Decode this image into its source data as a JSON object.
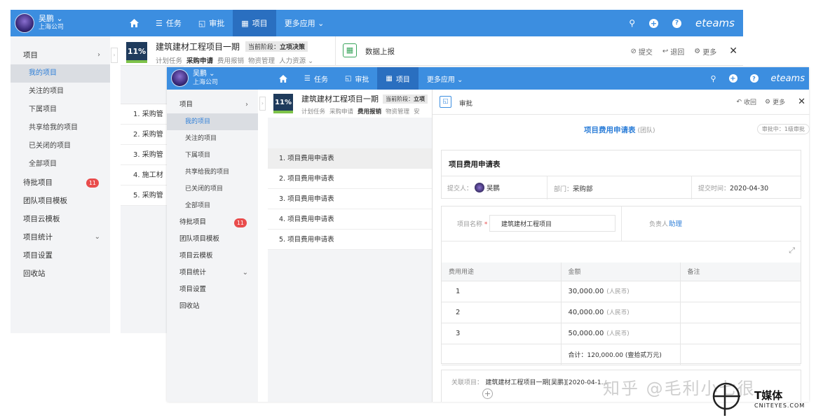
{
  "back": {
    "user": {
      "name": "吴鹏 ⌄",
      "company": "上海公司"
    },
    "nav": [
      {
        "label": "任务",
        "icon": "list-icon"
      },
      {
        "label": "审批",
        "icon": "approval-icon"
      },
      {
        "label": "项目",
        "icon": "project-icon"
      },
      {
        "label": "更多应用 ⌄",
        "icon": ""
      }
    ],
    "brand": "eteams",
    "sidebar": {
      "group": "项目",
      "items": [
        "我的项目",
        "关注的项目",
        "下属项目",
        "共享给我的项目",
        "已关闭的项目",
        "全部项目"
      ],
      "pending": "待批项目",
      "pending_count": "11",
      "others": [
        "团队项目模板",
        "项目云模板",
        "项目统计",
        "项目设置",
        "回收站"
      ]
    },
    "project": {
      "pct": "11%",
      "title": "建筑建材工程项目一期",
      "stage_label": "当前阶段：",
      "stage": "立项决策",
      "subnav": [
        "计划任务",
        "采购申请",
        "费用报销",
        "物资管理",
        "人力资源 ⌄"
      ],
      "data_report": "数据上报",
      "actions": {
        "submit": "提交",
        "return": "退回",
        "more": "更多"
      }
    },
    "list": [
      "1.  采购管",
      "2.  采购管",
      "3.  采购管",
      "4.  施工材",
      "5.  采购管"
    ]
  },
  "front": {
    "user": {
      "name": "吴鹏 ⌄",
      "company": "上海公司"
    },
    "nav": [
      {
        "label": "任务"
      },
      {
        "label": "审批"
      },
      {
        "label": "项目"
      },
      {
        "label": "更多应用 ⌄"
      }
    ],
    "brand": "eteams",
    "sidebar": {
      "group": "项目",
      "items": [
        "我的项目",
        "关注的项目",
        "下属项目",
        "共享给我的项目",
        "已关闭的项目",
        "全部项目"
      ],
      "pending": "待批项目",
      "pending_count": "11",
      "others": [
        "团队项目模板",
        "项目云模板",
        "项目统计",
        "项目设置",
        "回收站"
      ]
    },
    "project": {
      "pct": "11%",
      "title": "建筑建材工程项目一期",
      "stage_label": "当前阶段：",
      "stage": "立项",
      "subnav": [
        "计划任务",
        "采购申请",
        "费用报销",
        "物资管理",
        "安"
      ]
    },
    "list": [
      "1.  项目费用申请表",
      "2.  项目费用申请表",
      "3.  项目费用申请表",
      "4.  项目费用申请表",
      "5.  项目费用申请表"
    ]
  },
  "approval": {
    "tab": "审批",
    "actions": {
      "collapse": "收回",
      "more": "更多"
    },
    "heading": "项目费用申请表",
    "heading_tag": "(团队)",
    "status": "审批中：1级审批",
    "form_title": "项目费用申请表",
    "submitter_label": "提交人：",
    "submitter": "吴鹏",
    "dept_label": "部门：",
    "dept": "采购部",
    "time_label": "提交时间：",
    "time": "2020-04-30",
    "project_name_label": "项目名称",
    "project_name": "建筑建材工程项目",
    "owner_label": "负责人",
    "owner": "助理",
    "columns": [
      "费用用途",
      "金额",
      "备注"
    ],
    "rows": [
      {
        "no": "1",
        "amount": "30,000.00",
        "unit": "(人民币)"
      },
      {
        "no": "2",
        "amount": "40,000.00",
        "unit": "(人民币)"
      },
      {
        "no": "3",
        "amount": "50,000.00",
        "unit": "(人民币)"
      }
    ],
    "total": "合计：120,000.00 (壹拾贰万元)",
    "related_label": "关联项目：",
    "related": "建筑建材工程项目一期[吴鹏][2020-04-1..."
  },
  "watermark": {
    "text": "知乎 @毛利小七很",
    "logo": "T媒体",
    "logo_sub": "CNITEYES.COM"
  },
  "colors": {
    "primary": "#3c8ee0",
    "active_nav": "#2a6fc0",
    "badge": "#e94c4c",
    "link": "#2f7fd8",
    "arrow": "#e02020"
  }
}
